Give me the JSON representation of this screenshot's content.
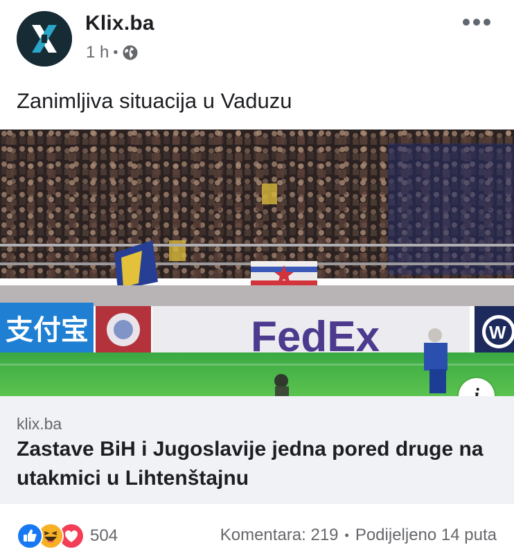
{
  "post": {
    "page_name": "Klix.ba",
    "time_ago": "1 h",
    "separator": "•",
    "audience_icon": "globe-icon",
    "more_icon": "more-options-icon",
    "caption": "Zanimljiva situacija u Vaduzu"
  },
  "link_preview": {
    "image_description_icon": "info-icon",
    "info_label": "i",
    "domain": "klix.ba",
    "title": "Zastave BiH i Jugoslavije jedna pored druge na utakmici u Lihtenštajnu",
    "image_ad_boards": [
      "FedEx"
    ]
  },
  "footer": {
    "reactions": [
      "like-icon",
      "haha-icon",
      "love-icon"
    ],
    "reaction_count": "504",
    "comments": "Komentara: 219",
    "shares": "Podijeljeno 14 puta",
    "separator": "•"
  },
  "colors": {
    "avatar_bg": "#172b35",
    "avatar_x": "#2aa6c9",
    "secondary_text": "#65676b",
    "link_box_bg": "#f0f2f5",
    "like_blue": "#1877f2",
    "love_red": "#f33e58",
    "haha_yellow": "#f7b125"
  }
}
